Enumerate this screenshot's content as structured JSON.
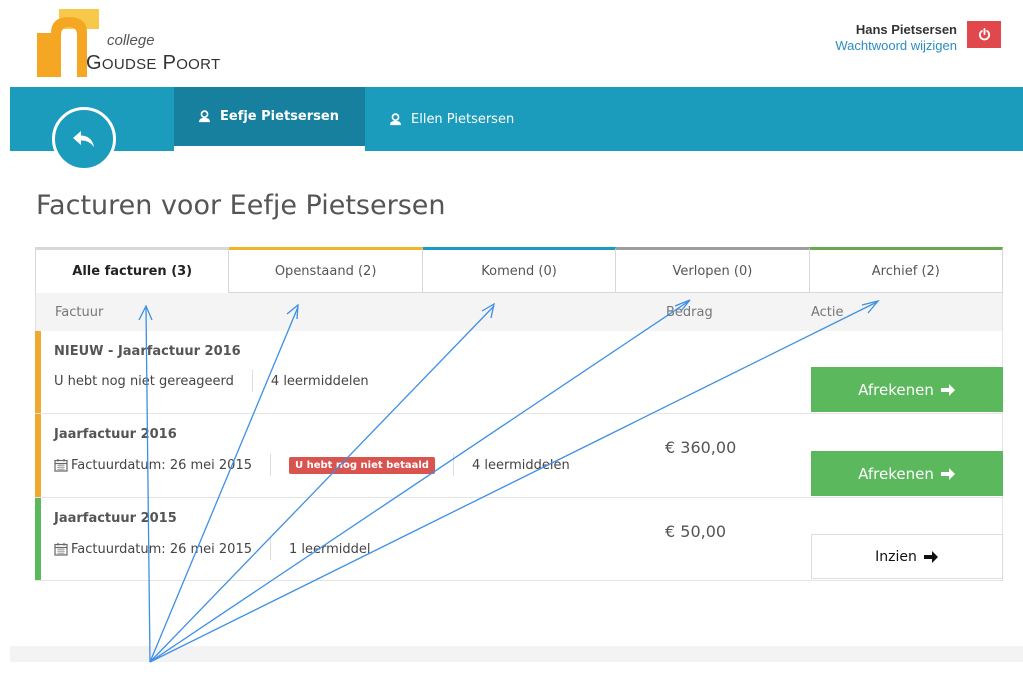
{
  "brand": {
    "college": "college",
    "name_first": "G",
    "name_first_rest": "OUDSE",
    "name_second": "P",
    "name_second_rest": "OORT",
    "colors": {
      "orange": "#f5a623",
      "yellow": "#f8c84a"
    }
  },
  "user": {
    "name": "Hans Pietsersen",
    "change_password": "Wachtwoord wijzigen",
    "logout_icon": "power-icon"
  },
  "nav": {
    "back_icon": "reply-arrow-icon",
    "students": [
      {
        "label": "Eefje Pietsersen",
        "active": true
      },
      {
        "label": "Ellen Pietsersen",
        "active": false
      }
    ],
    "color": "#1b9cbd"
  },
  "page": {
    "title": "Facturen voor Eefje Pietsersen"
  },
  "filters": [
    {
      "label": "Alle facturen (3)",
      "active": true,
      "accent": "#d8d8d8"
    },
    {
      "label": "Openstaand (2)",
      "active": false,
      "accent": "#f0b429"
    },
    {
      "label": "Komend (0)",
      "active": false,
      "accent": "#1b9cbd"
    },
    {
      "label": "Verlopen (0)",
      "active": false,
      "accent": "#9e9e9e"
    },
    {
      "label": "Archief (2)",
      "active": false,
      "accent": "#6aa84f"
    }
  ],
  "table": {
    "headers": {
      "invoice": "Factuur",
      "amount": "Bedrag",
      "action": "Actie"
    },
    "rows": [
      {
        "title": "NIEUW - Jaarfactuur 2016",
        "status_text": "U hebt nog niet gereageerd",
        "items": "4 leermiddelen",
        "amount": "",
        "action": "Afrekenen",
        "stripe": "#f0a830"
      },
      {
        "title": "Jaarfactuur 2016",
        "date": "Factuurdatum: 26 mei 2015",
        "badge": "U hebt nog niet betaald",
        "items": "4 leermiddelen",
        "amount": "€ 360,00",
        "action": "Afrekenen",
        "stripe": "#f0a830"
      },
      {
        "title": "Jaarfactuur 2015",
        "date": "Factuurdatum: 26 mei 2015",
        "items": "1 leermiddel",
        "amount": "€ 50,00",
        "action": "Inzien",
        "stripe": "#5cb85c"
      }
    ]
  }
}
